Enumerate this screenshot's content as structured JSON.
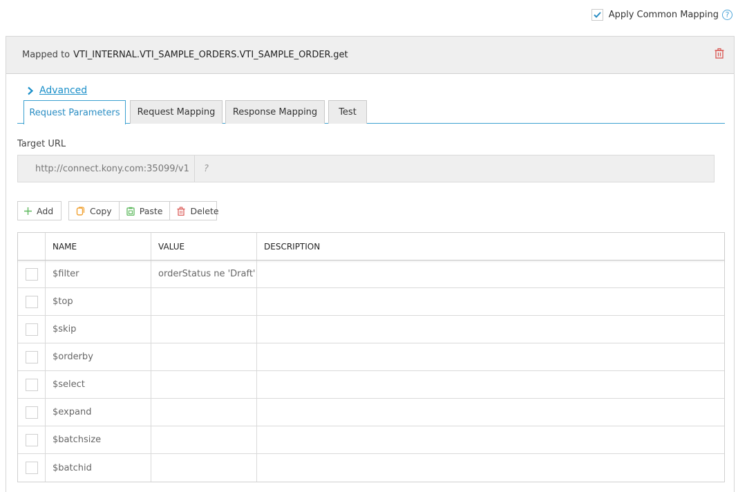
{
  "apply_common_mapping": {
    "label": "Apply Common Mapping",
    "checked": true,
    "help_glyph": "?"
  },
  "header": {
    "prefix": "Mapped to",
    "target": "VTI_INTERNAL.VTI_SAMPLE_ORDERS.VTI_SAMPLE_ORDER.get"
  },
  "advanced": {
    "label": "Advanced"
  },
  "tabs": [
    {
      "label": "Request Parameters",
      "active": true
    },
    {
      "label": "Request Mapping",
      "active": false
    },
    {
      "label": "Response Mapping",
      "active": false
    },
    {
      "label": "Test",
      "active": false
    }
  ],
  "target_url": {
    "label": "Target URL",
    "base": "http://connect.kony.com:35099/v1",
    "path_placeholder": "?"
  },
  "toolbar": {
    "add": "Add",
    "copy": "Copy",
    "paste": "Paste",
    "delete": "Delete"
  },
  "table": {
    "columns": [
      "NAME",
      "VALUE",
      "DESCRIPTION"
    ],
    "rows": [
      {
        "name": "$filter",
        "value": "orderStatus ne 'Draft'",
        "description": ""
      },
      {
        "name": "$top",
        "value": "",
        "description": ""
      },
      {
        "name": "$skip",
        "value": "",
        "description": ""
      },
      {
        "name": "$orderby",
        "value": "",
        "description": ""
      },
      {
        "name": "$select",
        "value": "",
        "description": ""
      },
      {
        "name": "$expand",
        "value": "",
        "description": ""
      },
      {
        "name": "$batchsize",
        "value": "",
        "description": ""
      },
      {
        "name": "$batchid",
        "value": "",
        "description": ""
      }
    ]
  },
  "colors": {
    "accent": "#2a8dc3",
    "delete_red": "#d9534f",
    "header_bg": "#efefef"
  },
  "icons": [
    "check-icon",
    "help-icon",
    "trash-icon",
    "chevron-right-icon",
    "plus-icon",
    "copy-icon",
    "paste-icon"
  ]
}
